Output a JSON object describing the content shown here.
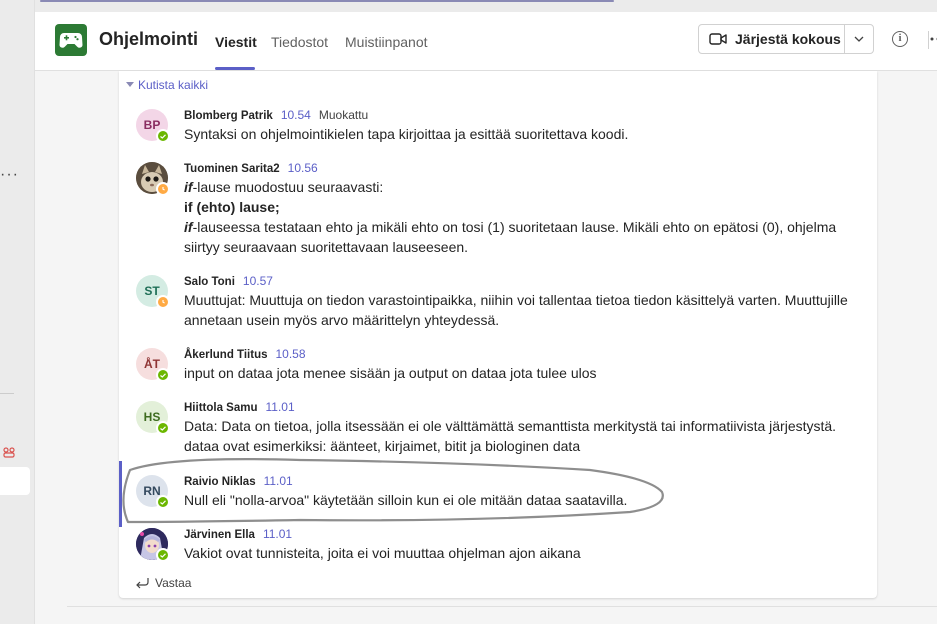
{
  "team": {
    "name": "Ohjelmointi"
  },
  "tabs": [
    {
      "label": "Viestit",
      "active": true
    },
    {
      "label": "Tiedostot",
      "active": false
    },
    {
      "label": "Muistiinpanot",
      "active": false
    }
  ],
  "header": {
    "meet_label": "Järjestä kokous",
    "info_icon": "info-icon",
    "meet_icon": "video-camera-icon"
  },
  "thread": {
    "collapse_label": "Kutista kaikki",
    "reply_label": "Vastaa"
  },
  "colors": {
    "accent": "#5b5fc7",
    "app_icon": "#2c7a34",
    "presence_available": "#6bb700",
    "presence_away": "#ffaa44"
  },
  "messages": [
    {
      "initials": "BP",
      "author": "Blomberg Patrik",
      "time": "10.54",
      "edited": "Muokattu",
      "presence": "available",
      "lines": [
        "Syntaksi on ohjelmointikielen tapa kirjoittaa ja esittää suoritettava koodi."
      ]
    },
    {
      "initials": "",
      "author": "Tuominen Sarita2",
      "time": "10.56",
      "presence": "away",
      "l1_em": "if",
      "l1_rest": "-lause muodostuu seuraavasti:",
      "l2": "if (ehto) lause;",
      "l3_em": "if",
      "l3_rest": "-lauseessa testataan ehto ja mikäli ehto on tosi (1) suoritetaan lause. Mikäli ehto on epätosi (0), ohjelma siirtyy seuraavaan suoritettavaan lauseeseen."
    },
    {
      "initials": "ST",
      "author": "Salo Toni",
      "time": "10.57",
      "presence": "away",
      "lines": [
        "Muuttujat: Muuttuja on tiedon varastointipaikka, niihin voi tallentaa tietoa tiedon käsittelyä varten. Muuttujille annetaan usein myös arvo määrittelyn yhteydessä."
      ]
    },
    {
      "initials": "ÅT",
      "author": "Åkerlund Tiitus",
      "time": "10.58",
      "presence": "available",
      "lines": [
        "input on dataa jota menee sisään ja output on dataa jota tulee ulos"
      ]
    },
    {
      "initials": "HS",
      "author": "Hiittola Samu",
      "time": "11.01",
      "presence": "available",
      "lines": [
        "Data:  Data on tietoa, jolla itsessään ei ole välttämättä semanttista merkitystä tai informatiivista järjestystä.",
        "dataa ovat esimerkiksi: äänteet, kirjaimet, bitit ja biologinen data"
      ]
    },
    {
      "initials": "RN",
      "author": "Raivio Niklas",
      "time": "11.01",
      "presence": "available",
      "lines": [
        "Null eli \"nolla-arvoa\" käytetään silloin kun ei ole mitään dataa saatavilla."
      ]
    },
    {
      "initials": "",
      "author": "Järvinen Ella",
      "time": "11.01",
      "presence": "available",
      "lines": [
        "Vakiot ovat tunnisteita, joita ei voi muuttaa ohjelman ajon aikana"
      ]
    }
  ]
}
